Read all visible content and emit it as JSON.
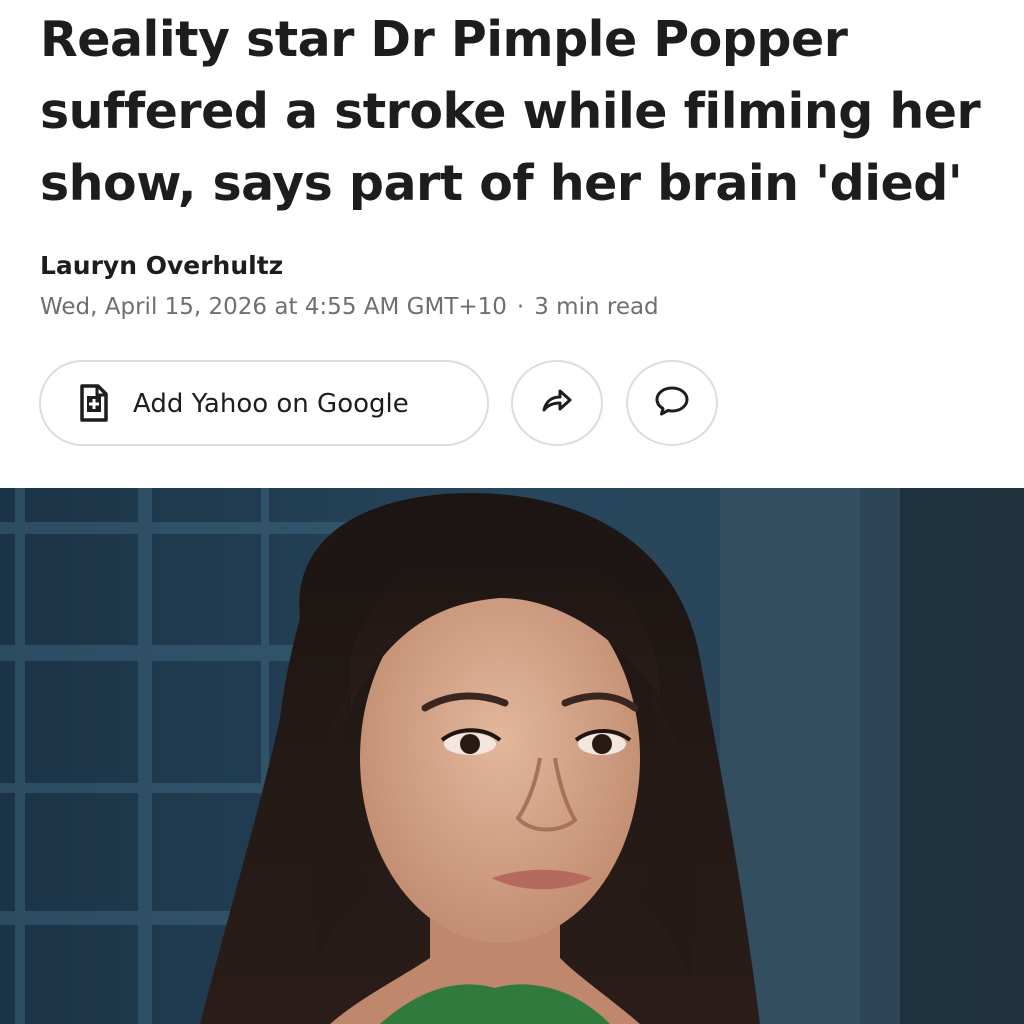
{
  "article": {
    "headline_lines": [
      "Reality star Dr Pimple Popper",
      "suffered a stroke while filming her",
      "show, says part of her brain 'died'"
    ],
    "author": "Lauryn Overhultz",
    "date": "Wed, April 15, 2026 at 4:55 AM GMT+10",
    "separator": "·",
    "read_time": "3 min read"
  },
  "actions": {
    "add_source_label": "Add Yahoo on Google",
    "add_source_icon": "document-plus-icon",
    "share_icon": "share-arrow-icon",
    "comment_icon": "comment-bubble-icon"
  },
  "colors": {
    "text": "#1d1d1f",
    "meta_text": "#6e6e73",
    "button_border": "#dcdcdf",
    "photo_background": "#1f3c52"
  }
}
